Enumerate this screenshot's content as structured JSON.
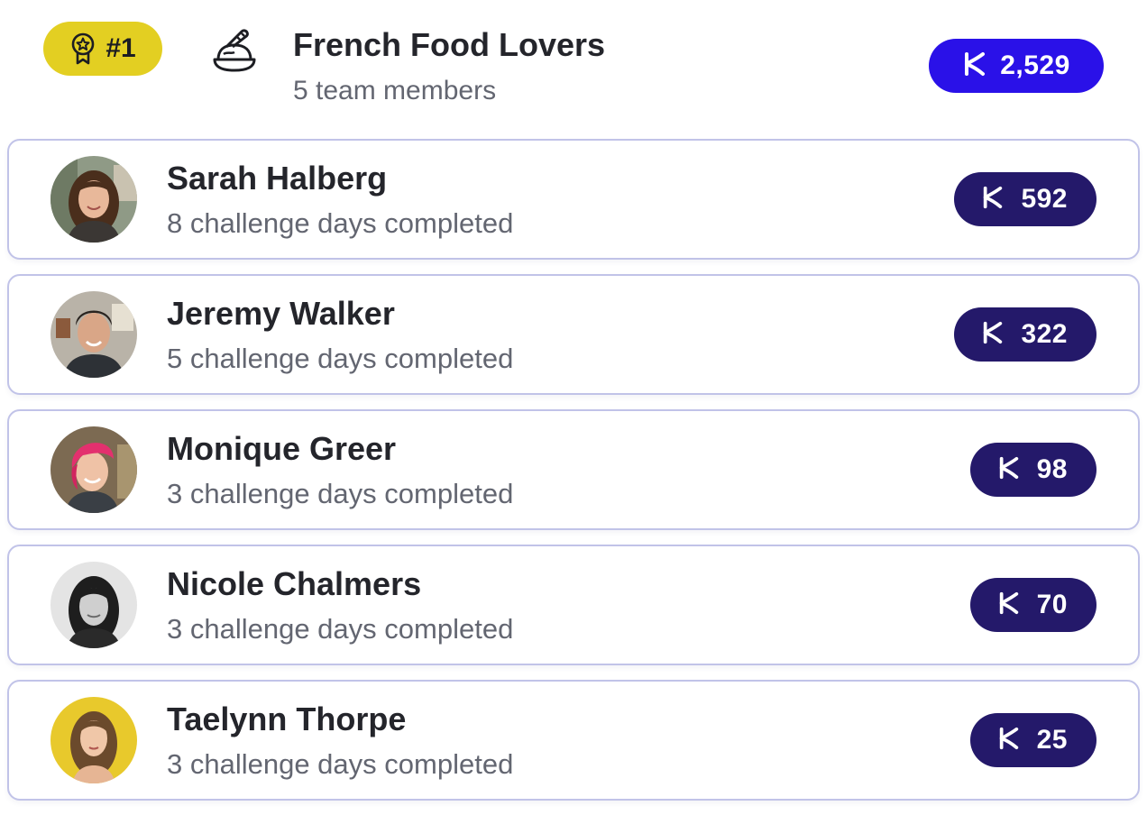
{
  "team": {
    "rank": "#1",
    "name": "French Food Lovers",
    "members_text": "5 team members",
    "points": "2,529"
  },
  "colors": {
    "rank_badge": "#e3cf22",
    "team_points_badge": "#2a11e8",
    "member_points_badge": "#24196a",
    "card_border": "#c1c3e8"
  },
  "icons": {
    "rank": "award-ribbon-icon",
    "team": "food-dish-icon",
    "points": "k-logo-icon"
  },
  "members": [
    {
      "name": "Sarah Halberg",
      "subtitle": "8 challenge days completed",
      "points": "592"
    },
    {
      "name": "Jeremy Walker",
      "subtitle": "5 challenge days completed",
      "points": "322"
    },
    {
      "name": "Monique Greer",
      "subtitle": "3 challenge days completed",
      "points": "98"
    },
    {
      "name": "Nicole Chalmers",
      "subtitle": "3 challenge days completed",
      "points": "70"
    },
    {
      "name": "Taelynn Thorpe",
      "subtitle": "3 challenge days completed",
      "points": "25"
    }
  ]
}
